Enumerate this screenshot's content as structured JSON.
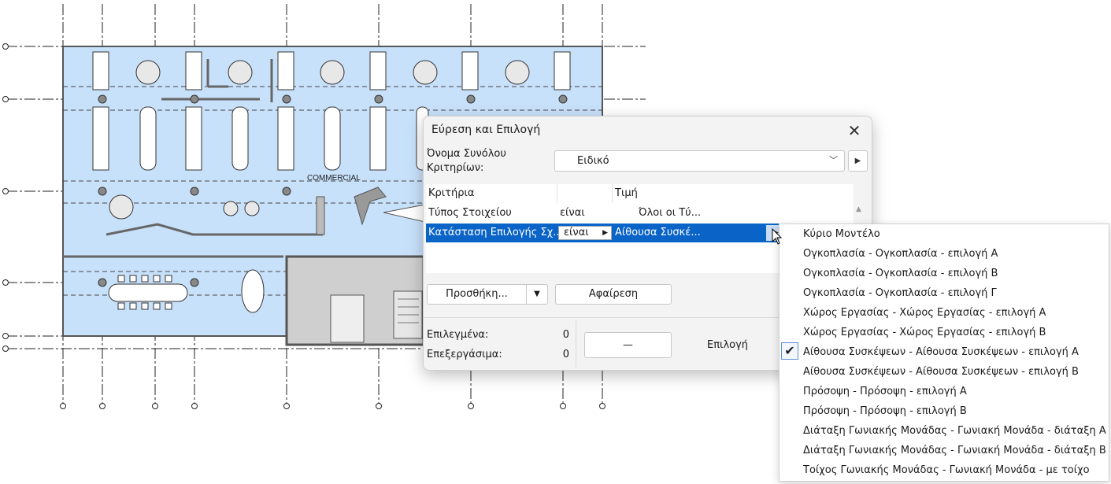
{
  "plan": {
    "label": "COMMERCIAL"
  },
  "dialog": {
    "title": "Εύρεση και Επιλογή",
    "close_icon": "close-icon",
    "criteria_set_label": "Όνομα Συνόλου Κριτηρίων:",
    "criteria_set_value": "Ειδικό",
    "table": {
      "headers": [
        "Κριτήρια",
        "",
        "Τιμή"
      ],
      "rows": [
        {
          "criterion": "Τύπος Στοιχείου",
          "operator": "είναι",
          "value": "Όλοι οι Τύ..."
        },
        {
          "criterion": "Κατάσταση Επιλογής Σχ...",
          "operator": "είναι",
          "value": "Αίθουσα Συσκέ..."
        }
      ]
    },
    "add_button": "Προσθήκη...",
    "remove_button": "Αφαίρεση",
    "selected_label": "Επιλεγμένα:",
    "selected_count": "0",
    "editable_label": "Επεξεργάσιμα:",
    "editable_count": "0",
    "minus_button": "—",
    "select_label": "Επιλογή"
  },
  "dropdown": {
    "checked_index": 6,
    "options": [
      "Κύριο Μοντέλο",
      "Ογκοπλασία - Ογκοπλασία - επιλογή Α",
      "Ογκοπλασία - Ογκοπλασία - επιλογή Β",
      "Ογκοπλασία - Ογκοπλασία - επιλογή Γ",
      "Χώρος Εργασίας - Χώρος Εργασίας - επιλογή Α",
      "Χώρος Εργασίας - Χώρος Εργασίας - επιλογή Β",
      "Αίθουσα Συσκέψεων - Αίθουσα Συσκέψεων - επιλογή Α",
      "Αίθουσα Συσκέψεων - Αίθουσα Συσκέψεων - επιλογή Β",
      "Πρόσοψη - Πρόσοψη - επιλογή Α",
      "Πρόσοψη - Πρόσοψη - επιλογή Β",
      "Διάταξη Γωνιακής Μονάδας - Γωνιακή Μονάδα - διάταξη Α",
      "Διάταξη Γωνιακής Μονάδας - Γωνιακή Μονάδα - διάταξη Β",
      "Τοίχος Γωνιακής Μονάδας - Γωνιακή Μονάδα - με τοίχο"
    ]
  },
  "colors": {
    "floor_fill": "#c8e1fb",
    "selection": "#0a63c6",
    "wall": "#8c8c8c"
  }
}
